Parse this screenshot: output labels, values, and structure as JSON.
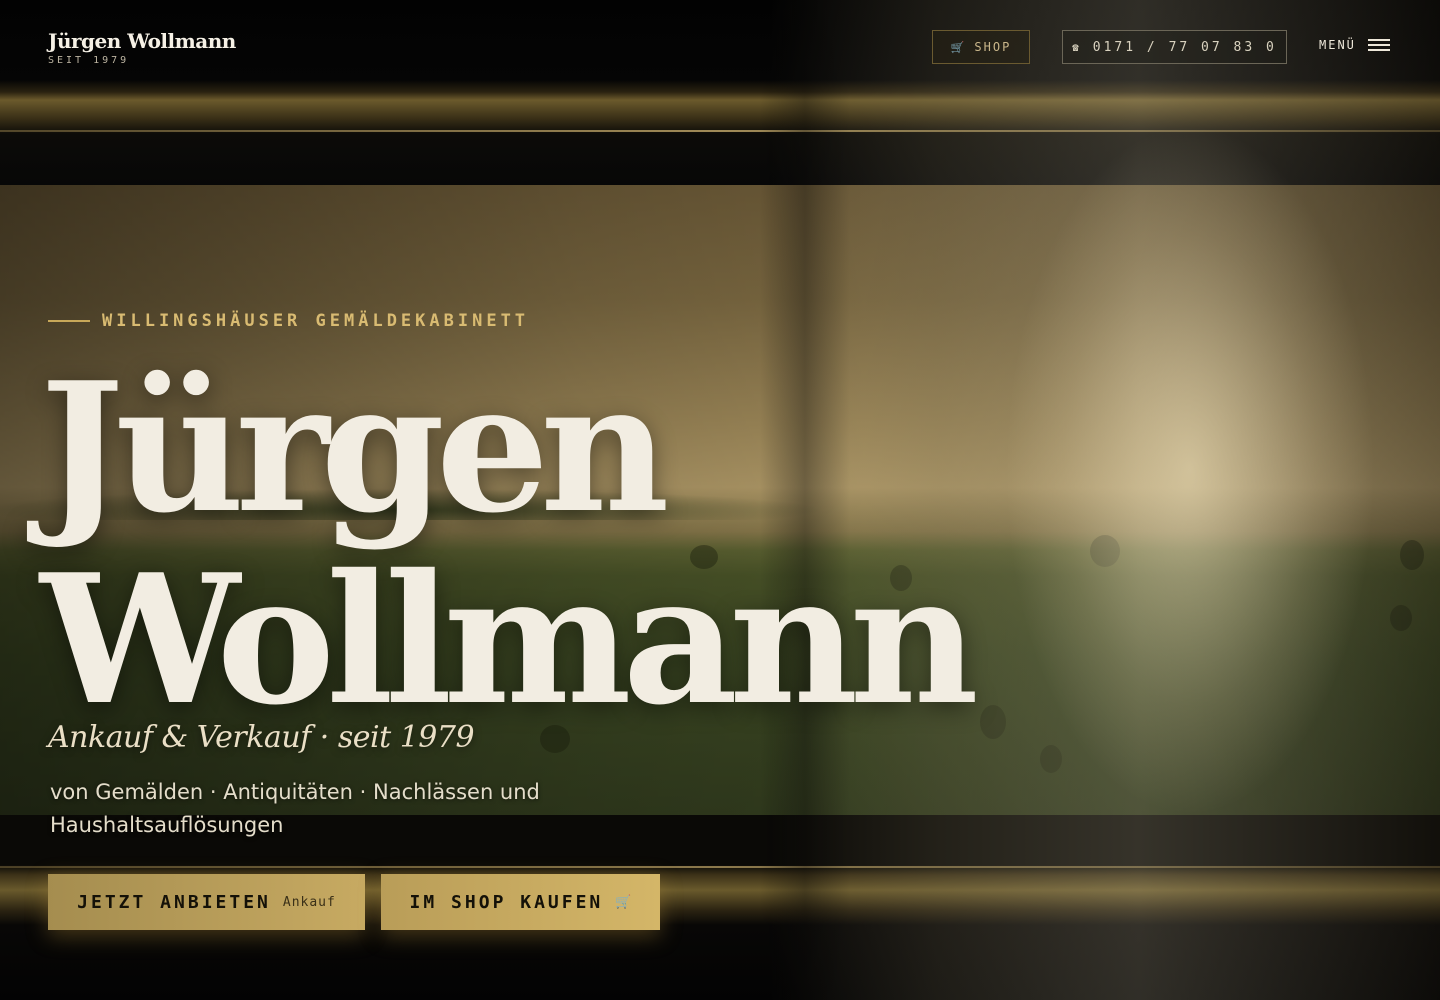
{
  "header": {
    "logo_name": "Jürgen Wollmann",
    "logo_sub": "SEIT 1979",
    "shop_label": "SHOP",
    "shop_icon": "cart-icon",
    "phone_icon": "phone-icon",
    "phone_label": "0171 / 77 07 83 0",
    "menu_label": "MENÜ"
  },
  "hero": {
    "eyebrow": "WILLINGSHÄUSER GEMÄLDEKABINETT",
    "title_line1": "Jürgen",
    "title_line2": "Wollmann",
    "tagline": "Ankauf & Verkauf · seit 1979",
    "description": "von Gemälden · Antiquitäten · Nachlässen und Haushaltsauflösungen",
    "cta_offer_label": "JETZT ANBIETEN",
    "cta_offer_sub": "Ankauf",
    "cta_shop_label": "IM SHOP KAUFEN",
    "cta_shop_icon": "cart-icon"
  },
  "colors": {
    "accent_gold": "#c8a859",
    "button_gold": "#c7aa62",
    "title_cream": "#f2ede2"
  }
}
